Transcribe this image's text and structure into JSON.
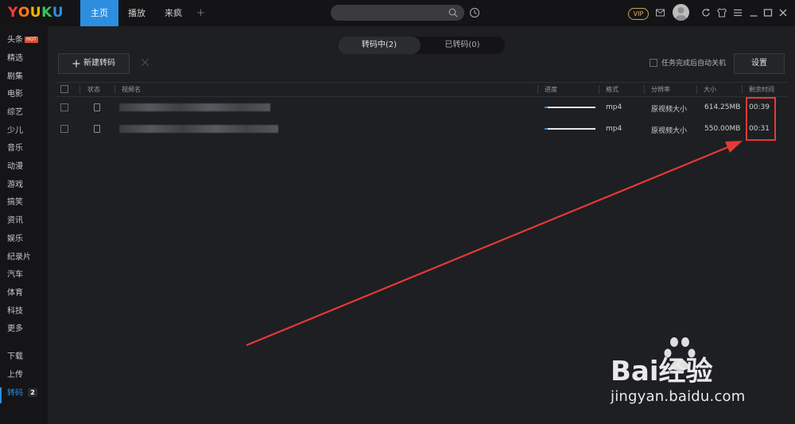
{
  "app": {
    "logo": "YOUKU",
    "logo_colors": [
      "#ff3b30",
      "#ff9500",
      "#ffcc00",
      "#34c759",
      "#2d8ee0"
    ]
  },
  "top_tabs": [
    {
      "label": "主页",
      "active": true
    },
    {
      "label": "播放",
      "active": false
    },
    {
      "label": "来疯",
      "active": false
    }
  ],
  "add_tab_label": "+",
  "header_right": {
    "vip_label": "VIP"
  },
  "sidebar": {
    "items": [
      {
        "label": "头条",
        "badge": "HOT"
      },
      {
        "label": "精选"
      },
      {
        "label": "剧集"
      },
      {
        "label": "电影"
      },
      {
        "label": "综艺"
      },
      {
        "label": "少儿"
      },
      {
        "label": "音乐"
      },
      {
        "label": "动漫"
      },
      {
        "label": "游戏"
      },
      {
        "label": "搞笑"
      },
      {
        "label": "资讯"
      },
      {
        "label": "娱乐"
      },
      {
        "label": "纪录片"
      },
      {
        "label": "汽车"
      },
      {
        "label": "体育"
      },
      {
        "label": "科技"
      },
      {
        "label": "更多"
      }
    ],
    "bottom_items": [
      {
        "label": "下载"
      },
      {
        "label": "上传"
      },
      {
        "label": "转码",
        "active": true,
        "count": "2"
      }
    ]
  },
  "segment_tabs": [
    {
      "label": "转码中(2)",
      "active": true
    },
    {
      "label": "已转码(0)",
      "active": false
    }
  ],
  "toolbar": {
    "new_transcode_label": "新建转码",
    "auto_shutdown_label": "任务完成后自动关机",
    "settings_label": "设置"
  },
  "table": {
    "columns": [
      "状态",
      "视频名",
      "进度",
      "格式",
      "分辨率",
      "大小",
      "剩余时间"
    ],
    "rows": [
      {
        "progress": 0.06,
        "format": "mp4",
        "resolution": "原视频大小",
        "size": "614.25MB",
        "remaining": "00:39"
      },
      {
        "progress": 0.06,
        "format": "mp4",
        "resolution": "原视频大小",
        "size": "550.00MB",
        "remaining": "00:31"
      }
    ]
  },
  "annotation": {
    "color": "#e33a35"
  },
  "watermark": {
    "brand_text": "Bai经验",
    "url": "jingyan.baidu.com"
  },
  "colors": {
    "accent": "#2d8ee0",
    "background": "#1e1f22",
    "sidebar": "#151518"
  }
}
